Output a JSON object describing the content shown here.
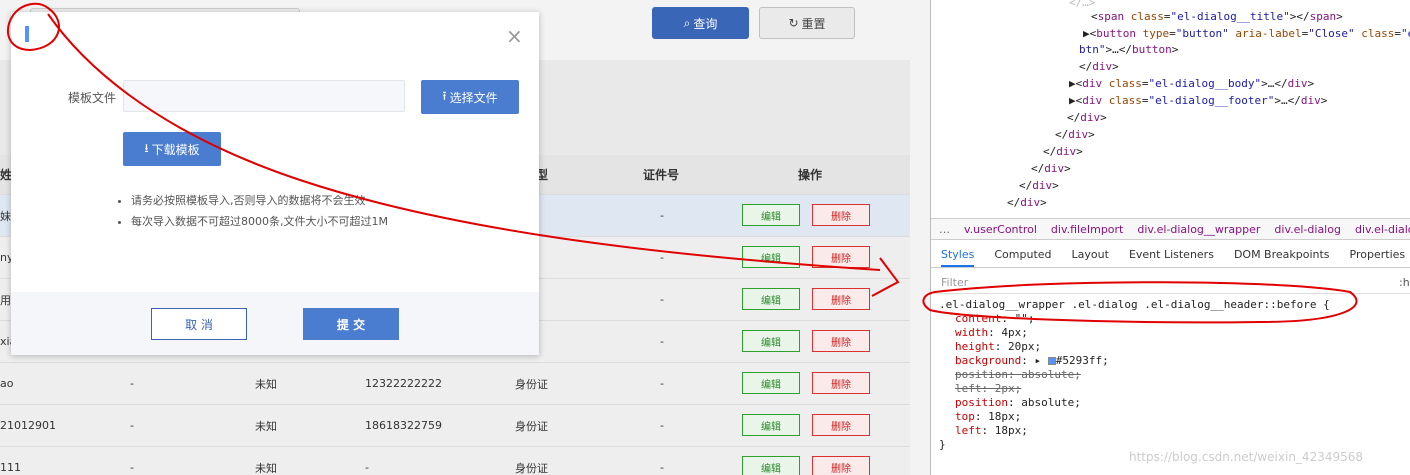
{
  "page": {
    "query_label": "查询",
    "reset_label": "重置"
  },
  "table": {
    "headers": [
      "姓",
      "型",
      "证件号",
      "操作"
    ],
    "rows": [
      {
        "c0": "妹宇",
        "c1": "",
        "c2": "",
        "c3": "",
        "c4": "证",
        "c5": "-",
        "hl": true
      },
      {
        "c0": "ny",
        "c1": "",
        "c2": "",
        "c3": "",
        "c4": "证",
        "c5": "-"
      },
      {
        "c0": "用",
        "c1": "",
        "c2": "",
        "c3": "",
        "c4": "证",
        "c5": "-"
      },
      {
        "c0": "xia",
        "c1": "",
        "c2": "",
        "c3": "",
        "c4": "证",
        "c5": "-"
      },
      {
        "c0": "ao",
        "c1": "-",
        "c2": "未知",
        "c3": "12322222222",
        "c4": "身份证",
        "c5": "-"
      },
      {
        "c0": "21012901",
        "c1": "-",
        "c2": "未知",
        "c3": "18618322759",
        "c4": "身份证",
        "c5": "-"
      },
      {
        "c0": "111",
        "c1": "-",
        "c2": "未知",
        "c3": "-",
        "c4": "身份证",
        "c5": "-"
      }
    ],
    "edit_label": "编辑",
    "delete_label": "删除"
  },
  "dialog": {
    "template_label": "模板文件",
    "template_value": "",
    "choose_label": "选择文件",
    "download_label": "下载模板",
    "tips": [
      "请务必按照模板导入,否则导入的数据将不会生效",
      "每次导入数据不可超过8000条,文件大小不可超过1M"
    ],
    "cancel_label": "取 消",
    "submit_label": "提 交",
    "close_symbol": "×"
  },
  "devtools": {
    "breadcrumbs": [
      "…",
      "v.userControl",
      "div.fileImport",
      "div.el-dialog__wrapper",
      "div.el-dialog",
      "div.el-dialog_"
    ],
    "tabs": [
      "Styles",
      "Computed",
      "Layout",
      "Event Listeners",
      "DOM Breakpoints",
      "Properties"
    ],
    "active_tab": "Styles",
    "filter_placeholder": "Filter",
    "filter_suffix": ":h",
    "selector": ".el-dialog__wrapper .el-dialog .el-dialog__header::before {",
    "declarations": [
      {
        "prop": "content",
        "value": "\"\";",
        "struck": false
      },
      {
        "prop": "width",
        "value": "4px;",
        "struck": false
      },
      {
        "prop": "height",
        "value": "20px;",
        "struck": false
      },
      {
        "prop": "background",
        "value": "#5293ff;",
        "struck": false
      },
      {
        "prop": "position",
        "value": "absolute;",
        "struck": true
      },
      {
        "prop": "left",
        "value": "2px;",
        "struck": true
      },
      {
        "prop": "position",
        "value": "absolute;",
        "struck": false
      },
      {
        "prop": "top",
        "value": "18px;",
        "struck": false
      },
      {
        "prop": "left",
        "value": "18px;",
        "struck": false
      }
    ],
    "closing": "}",
    "swatch_color": "#5293ff",
    "watermark": "https://blog.csdn.net/weixin_42349568"
  }
}
